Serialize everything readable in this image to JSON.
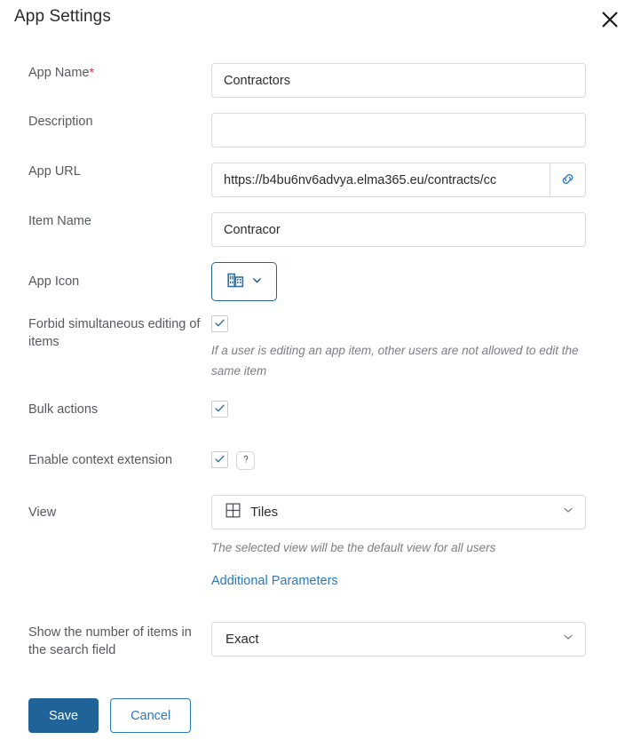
{
  "header": {
    "title": "App Settings",
    "close_icon": "close-icon"
  },
  "fields": {
    "app_name": {
      "label": "App Name",
      "required_marker": "*",
      "value": "Contractors",
      "placeholder": ""
    },
    "description": {
      "label": "Description",
      "value": "",
      "placeholder": ""
    },
    "app_url": {
      "label": "App URL",
      "value": "https://b4bu6nv6advya.elma365.eu/contracts/cc",
      "placeholder": "",
      "button_icon": "link-icon"
    },
    "item_name": {
      "label": "Item Name",
      "value": "Contracor",
      "placeholder": ""
    },
    "app_icon": {
      "label": "App Icon",
      "icon": "office-building-icon",
      "chevron": "chevron-down-icon"
    },
    "forbid_simultaneous": {
      "label": "Forbid simultaneous editing of items",
      "checked": true,
      "hint": "If a user is editing an app item, other users are not allowed to edit the same item"
    },
    "bulk_actions": {
      "label": "Bulk actions",
      "checked": true
    },
    "context_extension": {
      "label": "Enable context extension",
      "checked": true,
      "help_icon": "question-mark-icon"
    },
    "view": {
      "label": "View",
      "value": "Tiles",
      "icon": "tiles-grid-icon",
      "hint": "The selected view will be the default view for all users"
    },
    "additional_parameters": {
      "link_label": "Additional Parameters"
    },
    "items_count": {
      "label": "Show the number of items in the search field",
      "value": "Exact"
    }
  },
  "footer": {
    "save_label": "Save",
    "cancel_label": "Cancel"
  },
  "colors": {
    "primary": "#1f6399",
    "link": "#2a78bd",
    "required": "#e03131",
    "label_text": "#555a5e",
    "hint_text": "#7b8084",
    "border": "#d8dadd"
  }
}
